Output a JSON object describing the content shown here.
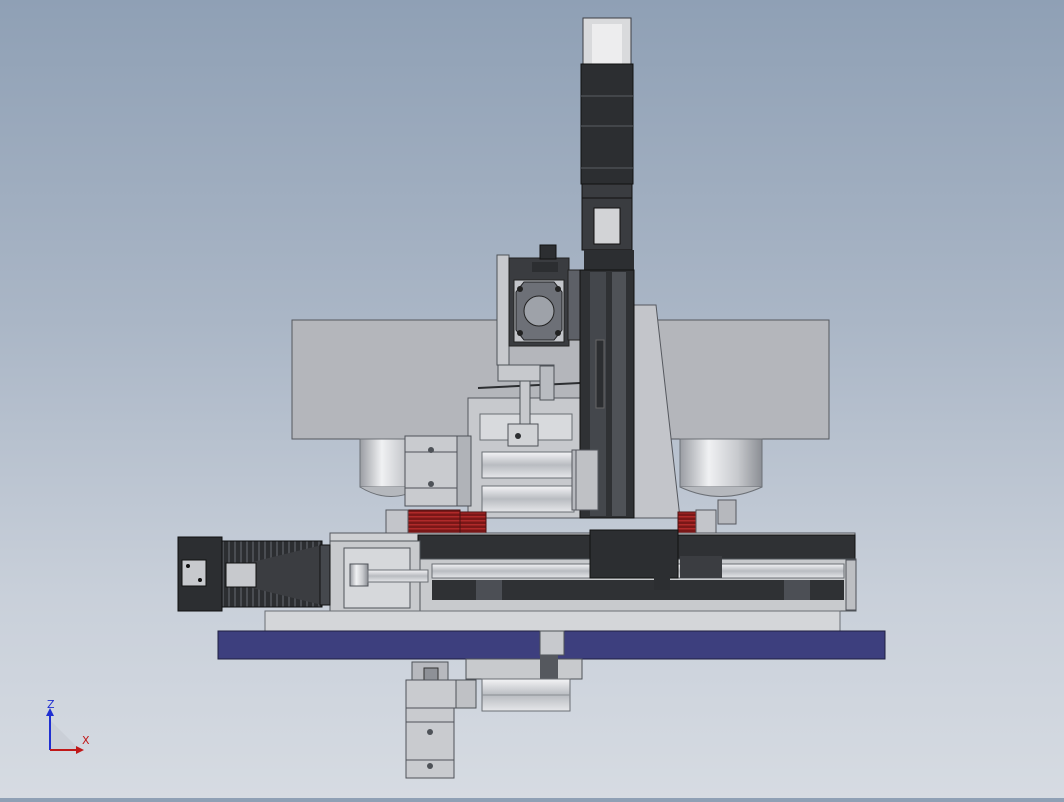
{
  "viewport": {
    "view_type": "front orthographic view of mechanical assembly",
    "colors": {
      "steel_light": "#c9ccd2",
      "steel_mid": "#9ea3ab",
      "steel_dark": "#5b5f66",
      "plate_gray": "#b4b6bb",
      "base_blue": "#3d3f7e",
      "motor_black": "#2c2e31",
      "accent_red": "#8c1c1c"
    }
  },
  "triad": {
    "z_label": "Z",
    "x_label": "X",
    "z_color": "#1f2fd1",
    "x_color": "#c01818"
  }
}
